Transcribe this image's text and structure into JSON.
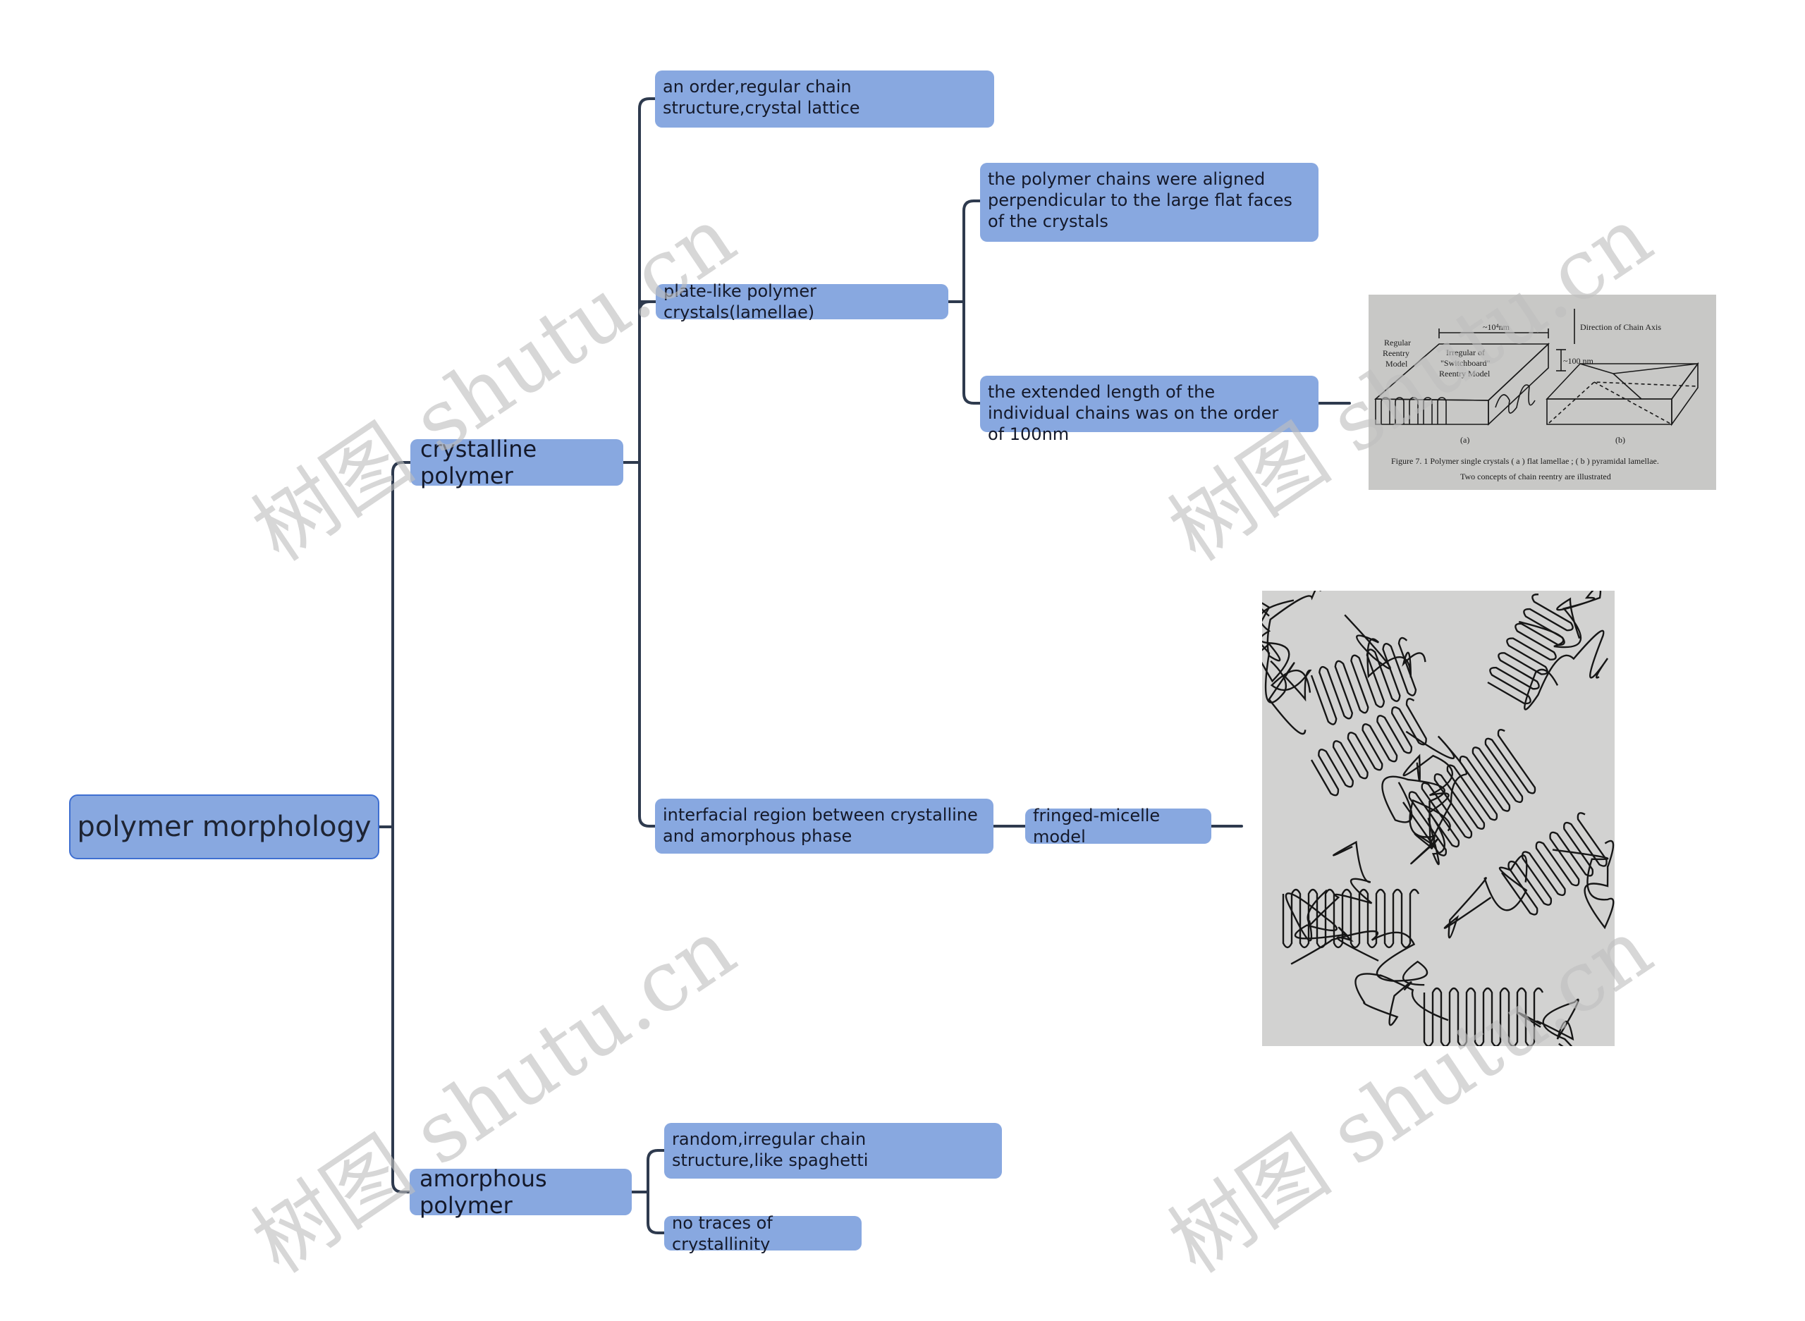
{
  "mindmap": {
    "root": {
      "label": "polymer morphology"
    },
    "crystalline": {
      "label": "crystalline polymer",
      "children": {
        "order": {
          "label": "an order,regular chain structure,crystal lattice"
        },
        "lamellae": {
          "label": "plate-like polymer crystals(lamellae)",
          "children": {
            "aligned": {
              "label": "the polymer chains were aligned perpendicular to the large flat faces of the crystals"
            },
            "extended": {
              "label": "the extended length of the individual chains was on the order of 100nm"
            }
          }
        },
        "interfacial": {
          "label": "interfacial region between crystalline and amorphous phase",
          "children": {
            "fringed": {
              "label": "fringed-micelle model"
            }
          }
        }
      }
    },
    "amorphous": {
      "label": "amorphous polymer",
      "children": {
        "random": {
          "label": "random,irregular chain structure,like spaghetti"
        },
        "no_traces": {
          "label": "no traces of crystallinity"
        }
      }
    }
  },
  "figures": {
    "lamellae_figure": {
      "label_regular": [
        "Regular",
        "Reentry",
        "Model"
      ],
      "label_irregular": [
        "Irregular of",
        "\"Switchboard\"",
        "Reentry Model"
      ],
      "dim_width": "~10⁴nm",
      "dim_height": "~100 nm",
      "axis_label": "Direction of Chain Axis",
      "sub_a": "(a)",
      "sub_b": "(b)",
      "caption_line1": "Figure 7. 1    Polymer single crystals ( a ) flat lamellae ; ( b ) pyramidal lamellae.",
      "caption_line2": "Two concepts of chain reentry are illustrated"
    },
    "fringed_micelle_figure": {
      "description": "fringed-micelle chain drawing"
    }
  },
  "watermark": {
    "text": "树图 shutu.cn"
  },
  "colors": {
    "node_fill": "#88a8e0",
    "root_border": "#3f6fd1",
    "connector": "#2e3a4e",
    "text": "#14192a"
  }
}
